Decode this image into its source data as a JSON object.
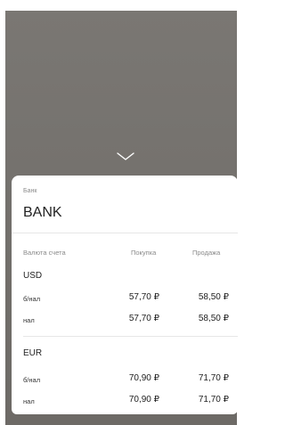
{
  "bank": {
    "caption": "Банк",
    "name": "BANK"
  },
  "table": {
    "headers": {
      "currency": "Валюта счета",
      "buy": "Покупка",
      "sell": "Продажа"
    },
    "groups": [
      {
        "currency": "USD",
        "rows": [
          {
            "label": "б/нал",
            "buy": "57,70 ₽",
            "sell": "58,50 ₽"
          },
          {
            "label": "нал",
            "buy": "57,70 ₽",
            "sell": "58,50 ₽"
          }
        ]
      },
      {
        "currency": "EUR",
        "rows": [
          {
            "label": "б/нал",
            "buy": "70,90 ₽",
            "sell": "71,70 ₽"
          },
          {
            "label": "нал",
            "buy": "70,90 ₽",
            "sell": "71,70 ₽"
          }
        ]
      }
    ]
  },
  "icons": {
    "collapse": "chevron-down-icon"
  },
  "colors": {
    "backdrop": "#757270",
    "card": "#ffffff"
  }
}
